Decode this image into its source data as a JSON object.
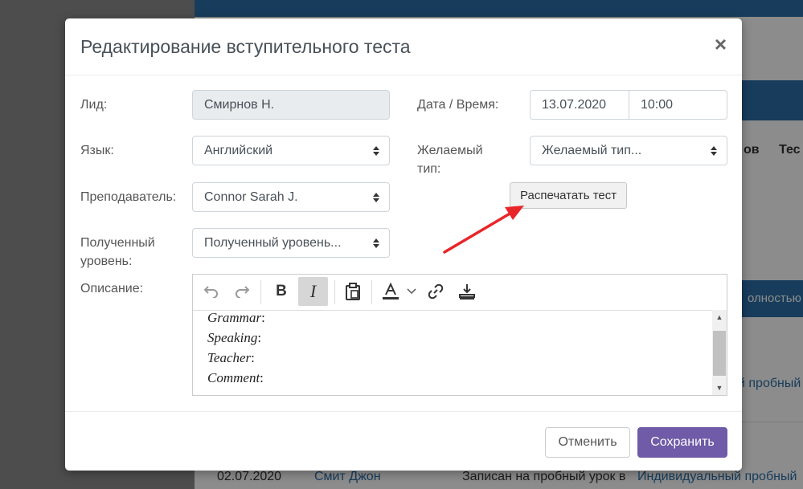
{
  "background": {
    "tabs": [
      "ов",
      "Тес"
    ],
    "strip_text": "олностью",
    "rows": [
      {
        "link": "й пробный"
      },
      {
        "date": "02.07.2020",
        "name": "Смит Джон",
        "status": "Записан на пробный урок в",
        "link": "Индивидуальный пробный"
      }
    ]
  },
  "modal": {
    "title": "Редактирование вступительного теста",
    "close_label": "×",
    "fields": {
      "lead": {
        "label": "Лид:",
        "value": "Смирнов Н."
      },
      "date_time": {
        "label": "Дата / Время:",
        "date": "13.07.2020",
        "time": "10:00"
      },
      "language": {
        "label": "Язык:",
        "value": "Английский"
      },
      "desired_type": {
        "label": "Желаемый тип:",
        "value": "Желаемый тип..."
      },
      "teacher": {
        "label": "Преподаватель:",
        "value": "Connor Sarah J."
      },
      "level": {
        "label": "Полученный уровень:",
        "value": "Полученный уровень..."
      },
      "description": {
        "label": "Описание:"
      }
    },
    "print_button": "Распечатать тест",
    "editor": {
      "toolbar": [
        "undo-icon",
        "redo-icon",
        "bold-icon",
        "italic-icon",
        "paste-icon",
        "text-color-icon",
        "link-icon",
        "download-icon"
      ],
      "bold_label": "B",
      "italic_label": "I",
      "lines": [
        {
          "label": "Grammar",
          "suffix": ":"
        },
        {
          "label": "Speaking",
          "suffix": ":"
        },
        {
          "label": "Teacher",
          "suffix": ":"
        },
        {
          "label": "Comment",
          "suffix": ":"
        }
      ]
    },
    "cancel_button": "Отменить",
    "save_button": "Сохранить",
    "colors": {
      "primary": "#6f5ba7",
      "header_blue": "#2c6fa8",
      "annotation_arrow": "#e8262a"
    }
  }
}
